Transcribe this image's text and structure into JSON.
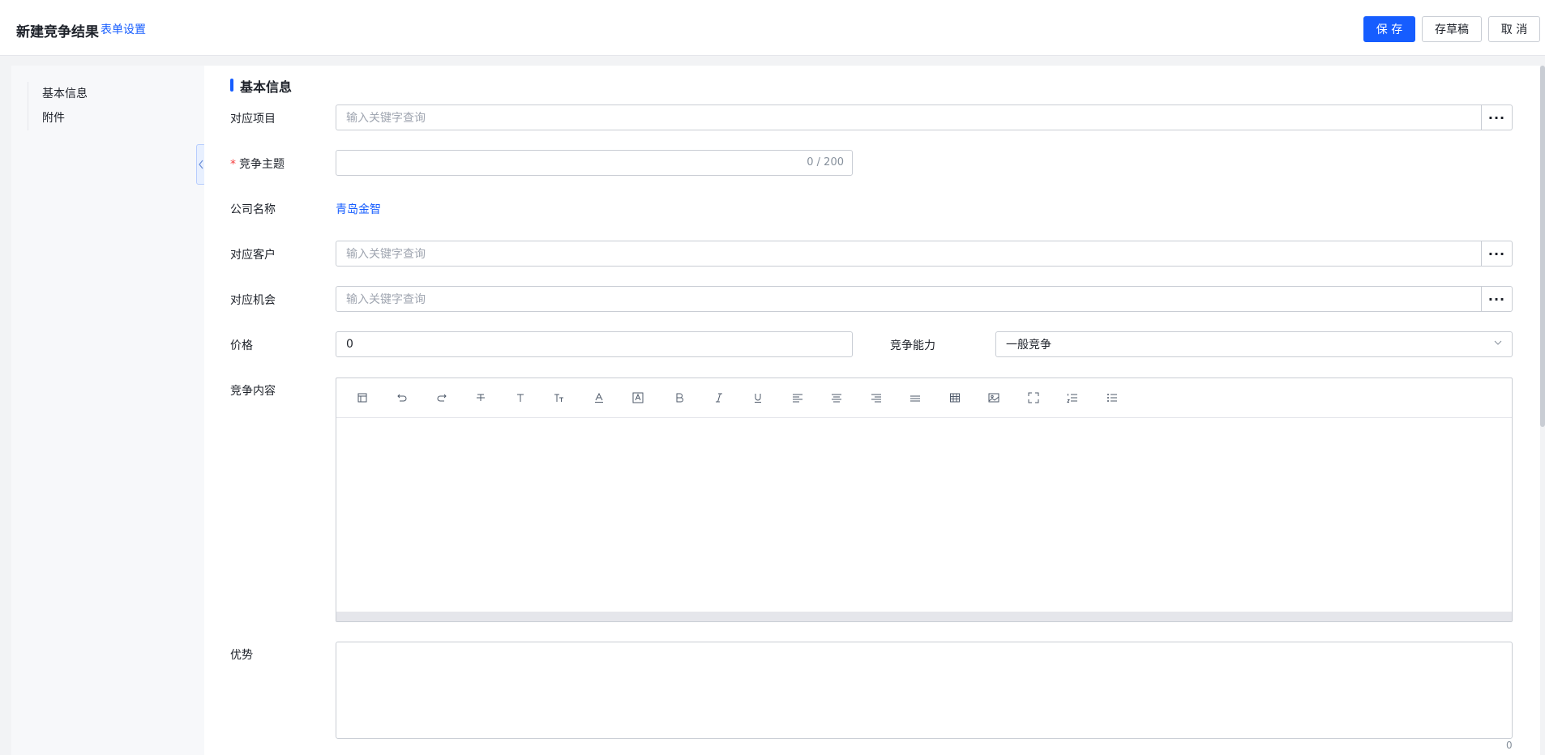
{
  "header": {
    "title": "新建竞争结果",
    "form_settings": "表单设置",
    "save_label": "保 存",
    "draft_label": "存草稿",
    "cancel_label": "取 消"
  },
  "sidebar": {
    "items": [
      {
        "label": "基本信息"
      },
      {
        "label": "附件"
      }
    ]
  },
  "form": {
    "section_title": "基本信息",
    "project_label": "对应项目",
    "project_placeholder": "输入关键字查询",
    "subject_label": "竞争主题",
    "subject_required": "*",
    "subject_counter": "0 / 200",
    "company_label": "公司名称",
    "company_value": "青岛金智",
    "customer_label": "对应客户",
    "customer_placeholder": "输入关键字查询",
    "opportunity_label": "对应机会",
    "opportunity_placeholder": "输入关键字查询",
    "price_label": "价格",
    "price_value": "0",
    "ability_label": "竞争能力",
    "ability_value": "一般竞争",
    "content_label": "竞争内容",
    "advantage_label": "优势",
    "advantage_count": "0",
    "dots": "···"
  },
  "editor_tools": [
    "template-icon",
    "undo-icon",
    "redo-icon",
    "strikethrough-icon",
    "font-size-icon",
    "text-case-icon",
    "font-color-icon",
    "background-color-icon",
    "bold-icon",
    "italic-icon",
    "underline-icon",
    "align-left-icon",
    "align-center-icon",
    "align-right-icon",
    "justify-icon",
    "table-icon",
    "image-icon",
    "fullscreen-icon",
    "ordered-list-icon",
    "bullet-list-icon"
  ],
  "colors": {
    "primary": "#165dff",
    "required": "#f53f3f"
  }
}
